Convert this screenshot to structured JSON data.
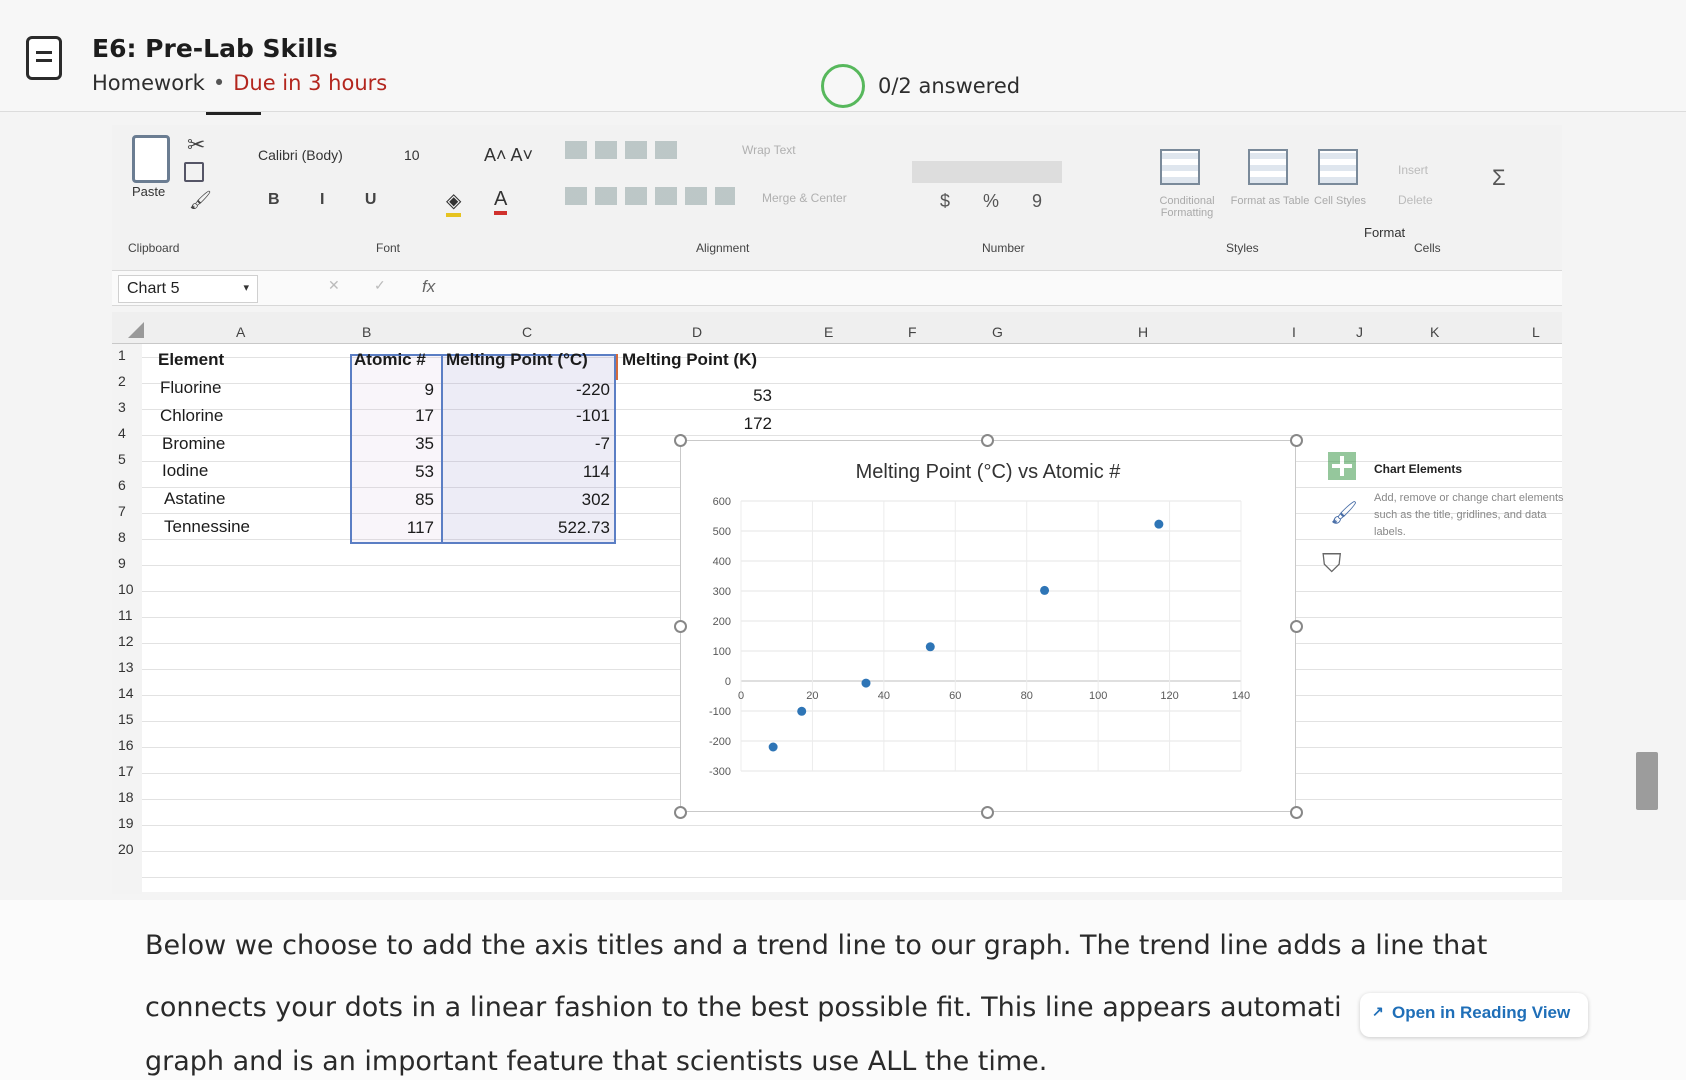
{
  "assignment": {
    "title": "E6: Pre-Lab Skills",
    "type": "Homework",
    "due": "Due in 3 hours",
    "progress": "0/2 answered"
  },
  "ribbon": {
    "paste": "Paste",
    "clipboard": "Clipboard",
    "font_name": "Calibri (Body)",
    "font_size": "10",
    "grow_shrink": "A˄ A˅",
    "bold_italic_underline": "B I U",
    "font_group": "Font",
    "alignment_group": "Alignment",
    "wrap_text": "Wrap Text",
    "merge_center": "Merge & Center",
    "currency": "$ % 9",
    "number_group": "Number",
    "conditional_formatting": "Conditional Formatting",
    "format_as_table": "Format as Table",
    "cell_styles": "Cell Styles",
    "styles_group": "Styles",
    "insert": "Insert",
    "delete": "Delete",
    "format": "Format",
    "cells_group": "Cells"
  },
  "formula_bar": {
    "name_box": "Chart 5",
    "fx": "fx"
  },
  "sheet": {
    "columns": [
      "A",
      "B",
      "C",
      "D",
      "E",
      "F",
      "G",
      "H",
      "I",
      "J",
      "K",
      "L"
    ],
    "rows": [
      "1",
      "2",
      "3",
      "4",
      "5",
      "6",
      "7",
      "8",
      "9",
      "10",
      "11",
      "12",
      "13",
      "14",
      "15",
      "16",
      "17",
      "18",
      "19",
      "20"
    ],
    "headers": {
      "element": "Element",
      "atomic": "Atomic #",
      "mp_c": "Melting Point (°C)",
      "mp_k": "Melting Point (K)"
    },
    "data": [
      {
        "element": "Fluorine",
        "atomic": "9",
        "mp_c": "-220",
        "mp_k": "53"
      },
      {
        "element": "Chlorine",
        "atomic": "17",
        "mp_c": "-101",
        "mp_k": "172"
      },
      {
        "element": "Bromine",
        "atomic": "35",
        "mp_c": "-7",
        "mp_k": ""
      },
      {
        "element": "Iodine",
        "atomic": "53",
        "mp_c": "114",
        "mp_k": ""
      },
      {
        "element": "Astatine",
        "atomic": "85",
        "mp_c": "302",
        "mp_k": ""
      },
      {
        "element": "Tennessine",
        "atomic": "117",
        "mp_c": "522.73",
        "mp_k": ""
      }
    ]
  },
  "chart_data": {
    "type": "scatter",
    "title": "Melting Point (°C) vs Atomic #",
    "xlabel": "",
    "ylabel": "",
    "xlim": [
      0,
      140
    ],
    "ylim": [
      -300,
      600
    ],
    "x_ticks": [
      "0",
      "20",
      "40",
      "60",
      "80",
      "100",
      "120",
      "140"
    ],
    "y_ticks": [
      "600",
      "500",
      "400",
      "300",
      "200",
      "100",
      "0",
      "-100",
      "-200",
      "-300"
    ],
    "grid": true,
    "color": "#2e75b6",
    "series": [
      {
        "x": [
          9,
          17,
          35,
          53,
          85,
          117
        ],
        "y": [
          -220,
          -101,
          -7,
          114,
          302,
          522.73
        ]
      }
    ]
  },
  "chart_elements_panel": {
    "title": "Chart Elements",
    "description": "Add, remove or change chart elements such as the title, gridlines, and data labels."
  },
  "reading": {
    "line1": "Below we choose to add the axis titles and a trend line to our graph. The trend line adds a line that",
    "line2": "connects your dots in a linear fashion to the best possible fit. This line appears automati",
    "line3": "graph and is an important feature that scientists use ALL the time.",
    "button": "Open in Reading View"
  }
}
